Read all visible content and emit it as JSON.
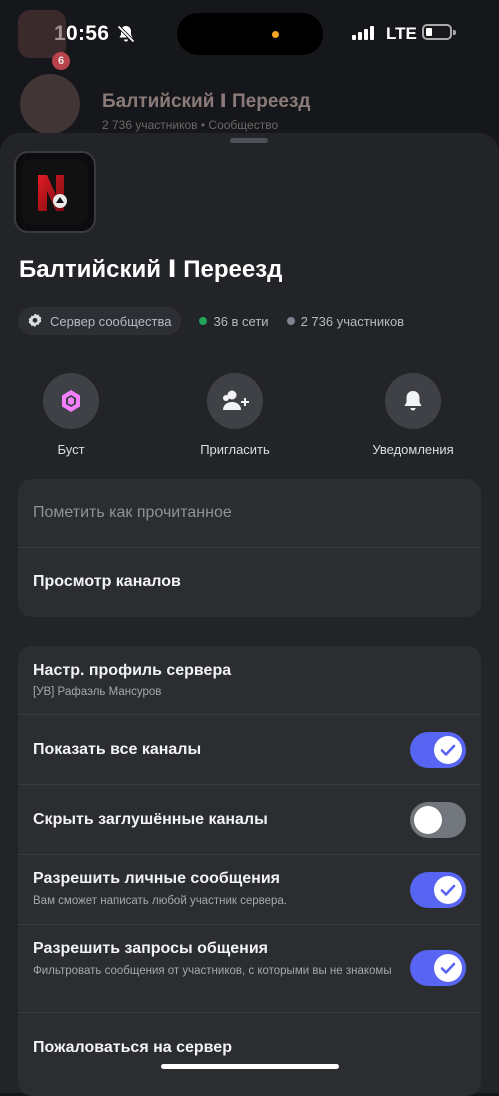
{
  "status": {
    "time": "10:56",
    "network": "LTE"
  },
  "background": {
    "badge": "6",
    "title": "Балтийский Ⅰ Переезд",
    "subtitle": "2 736 участников  •  Сообщество"
  },
  "server": {
    "name": "Балтийский Ⅰ Переезд",
    "community_chip": "Сервер сообщества",
    "online": "36 в сети",
    "members": "2 736 участников",
    "colors": {
      "online": "#23a55a",
      "offline": "#80848e",
      "accent": "#5865f2"
    }
  },
  "actions": [
    {
      "label": "Буст",
      "icon": "boost-gem-icon"
    },
    {
      "label": "Пригласить",
      "icon": "invite-user-icon"
    },
    {
      "label": "Уведомления",
      "icon": "bell-icon"
    }
  ],
  "menu1": {
    "mark_read": "Пометить как прочитанное",
    "browse_channels": "Просмотр каналов"
  },
  "settings": {
    "profile_title": "Настр. профиль сервера",
    "profile_sub": "[УВ] Рафаэль Мансуров",
    "show_all": "Показать все каналы",
    "show_all_on": true,
    "hide_muted": "Скрыть заглушённые каналы",
    "hide_muted_on": false,
    "allow_dm": "Разрешить личные сообщения",
    "allow_dm_sub": "Вам сможет написать любой участник сервера.",
    "allow_dm_on": true,
    "allow_requests": "Разрешить запросы общения",
    "allow_requests_sub": "Фильтровать сообщения от участников, с которыми вы не знакомы",
    "allow_requests_on": true,
    "report": "Пожаловаться на сервер"
  }
}
